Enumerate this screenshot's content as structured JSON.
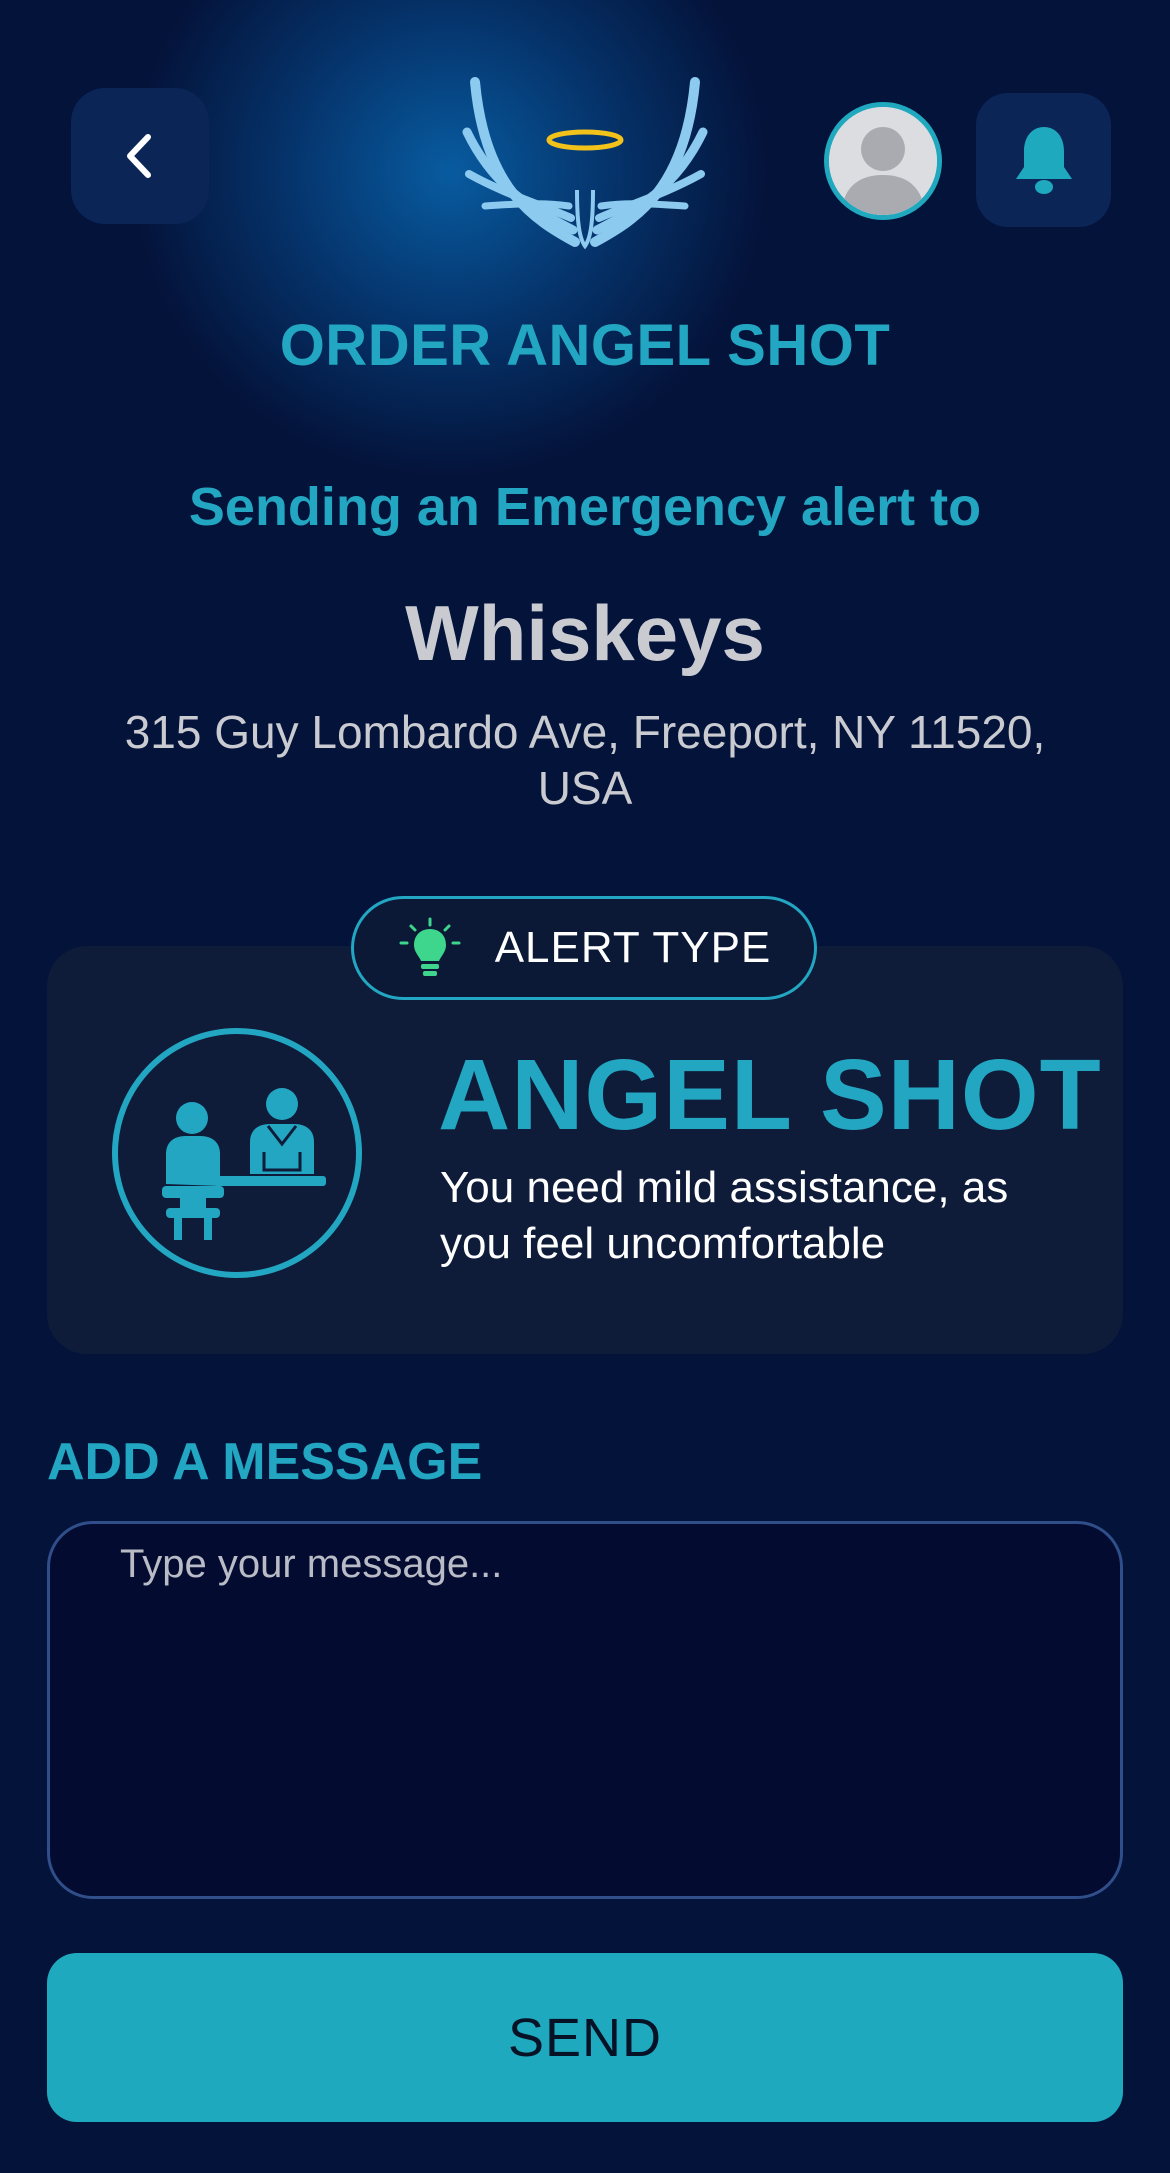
{
  "colors": {
    "background": "#04133a",
    "accent": "#22a6c2",
    "card": "#0e1c39",
    "button": "#1fa9bf",
    "bulb": "#3dd68c",
    "halo": "#f2c21b",
    "wings": "#8ccaf0"
  },
  "header": {
    "back_icon": "chevron-left-icon",
    "logo_icon": "angel-wings-halo-logo",
    "avatar_icon": "user-avatar-placeholder",
    "bell_icon": "bell-icon"
  },
  "page": {
    "title": "ORDER ANGEL SHOT",
    "sending_label": "Sending an Emergency alert to"
  },
  "venue": {
    "name": "Whiskeys",
    "address": "315 Guy Lombardo Ave, Freeport, NY 11520, USA"
  },
  "alert": {
    "pill_label": "ALERT TYPE",
    "pill_icon": "lightbulb-icon",
    "illustration": "bar-patron-and-bartender-icon",
    "name": "ANGEL SHOT",
    "description": "You need mild assistance, as you feel uncomfortable"
  },
  "message": {
    "heading": "ADD A MESSAGE",
    "placeholder": "Type your message..."
  },
  "actions": {
    "send_label": "SEND"
  }
}
